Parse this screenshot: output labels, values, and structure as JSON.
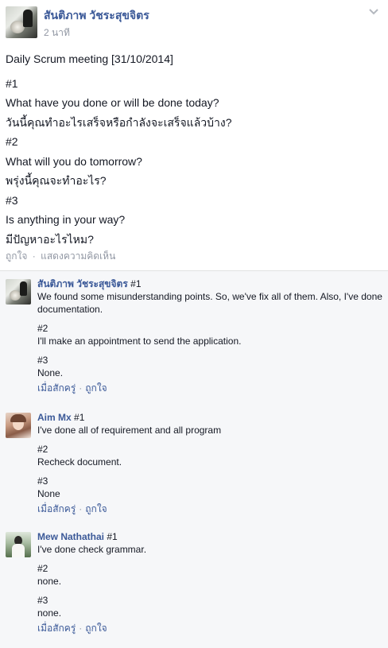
{
  "post": {
    "author": "สันติภาพ วัชระสุขจิตร",
    "time": "2 นาที",
    "lines": [
      "Daily Scrum meeting [31/10/2014]",
      "",
      "#1",
      "What have you done or will be done today?",
      "วันนี้คุณทำอะไรเสร็จหรือกำลังจะเสร็จแล้วบ้าง?",
      "#2",
      "What will you do tomorrow?",
      "พรุ่งนี้คุณจะทำอะไร?",
      "#3",
      "Is anything in your way?",
      "มีปัญหาอะไรไหม?"
    ],
    "actions": {
      "like": "ถูกใจ",
      "separator": "·",
      "comment": "แสดงความคิดเห็น"
    }
  },
  "comments": [
    {
      "name": "สันติภาพ วัชระสุขจิตร",
      "first_line": "#1",
      "paragraphs": [
        "We found some misunderstanding points. So, we've fix all of them. Also, I've done documentation.",
        "#2",
        "I'll make an appointment to send the application.",
        "#3",
        "None."
      ],
      "time": "เมื่อสักครู่",
      "like": "ถูกใจ"
    },
    {
      "name": "Aim Mx",
      "first_line": "#1",
      "paragraphs": [
        "I've done all of requirement and all program",
        "#2",
        "Recheck document.",
        "#3",
        "None"
      ],
      "time": "เมื่อสักครู่",
      "like": "ถูกใจ"
    },
    {
      "name": "Mew Nathathai",
      "first_line": "#1",
      "paragraphs": [
        "I've done check grammar.",
        "#2",
        "none.",
        "#3",
        "none."
      ],
      "time": "เมื่อสักครู่",
      "like": "ถูกใจ"
    }
  ],
  "icons": {
    "post_menu": "chevron-down-icon"
  }
}
